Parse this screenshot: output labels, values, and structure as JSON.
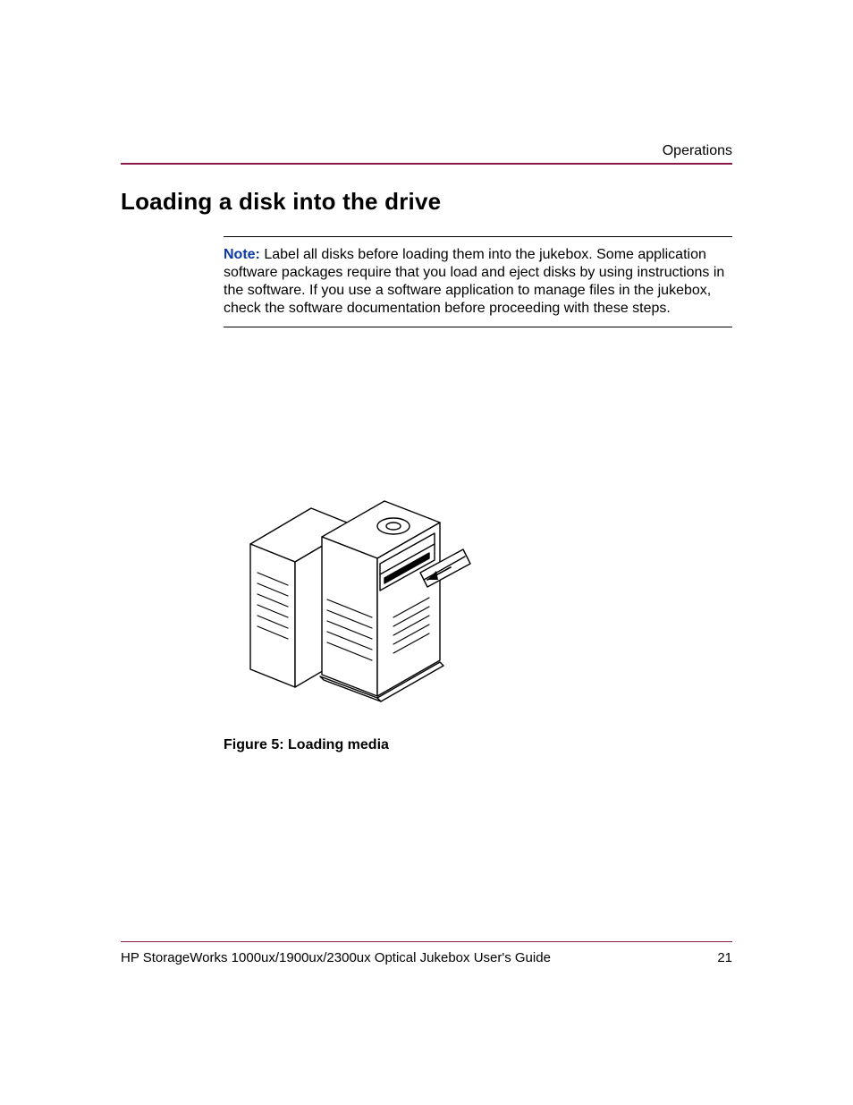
{
  "header": {
    "section": "Operations"
  },
  "heading": "Loading a disk into the drive",
  "note": {
    "label": "Note:",
    "text": "Label all disks before loading them into the jukebox. Some application software packages require that you load and eject disks by using instructions in the software. If you use a software application to manage files in the jukebox, check the software documentation before proceeding with these steps."
  },
  "figure": {
    "caption_prefix": "Figure 5:  ",
    "caption_title": "Loading media",
    "alt": "Line drawing of an optical jukebox with a disk cartridge being inserted into the drive slot"
  },
  "footer": {
    "title": "HP StorageWorks 1000ux/1900ux/2300ux Optical Jukebox User's Guide",
    "page": "21"
  }
}
